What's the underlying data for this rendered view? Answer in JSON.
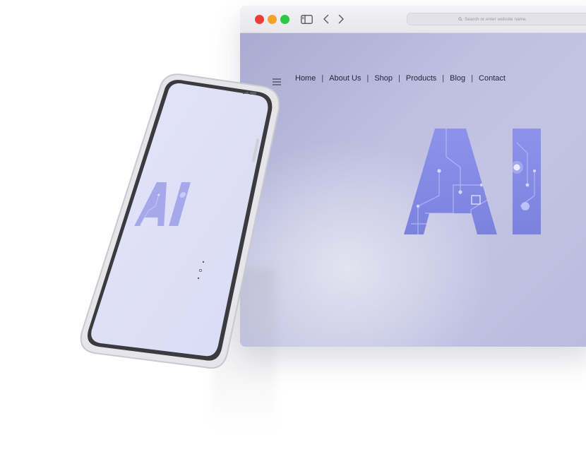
{
  "browser": {
    "address_placeholder": "Search or enter website name",
    "toolbar_icons": [
      "sidebar-icon",
      "back-icon",
      "forward-icon",
      "search-icon"
    ]
  },
  "site": {
    "nav": {
      "items": [
        "Home",
        "About Us",
        "Shop",
        "Products",
        "Blog",
        "Contact"
      ],
      "separator": "|"
    },
    "hero_text": "AI"
  },
  "phone": {
    "hero_text": "AI"
  },
  "colors": {
    "accent": "#7f86e3",
    "page_background": "#c3c4e4",
    "phone_screen": "#e3e4f7",
    "traffic_red": "#f03b3b",
    "traffic_yellow": "#f4a32a",
    "traffic_green": "#2bc844"
  }
}
